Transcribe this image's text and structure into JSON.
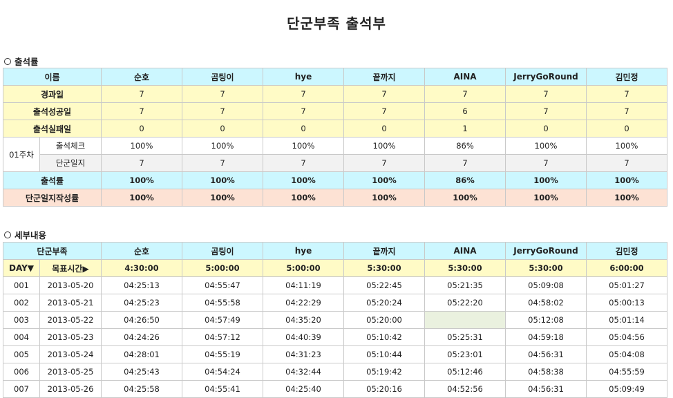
{
  "title": "단군부족 출석부",
  "attendance": {
    "section_label": "출석률",
    "header_label": "이름",
    "members": [
      "순호",
      "곰팅이",
      "hye",
      "끝까지",
      "AINA",
      "JerryGoRound",
      "김민정"
    ],
    "rows": {
      "elapsed": {
        "label": "경과일",
        "values": [
          "7",
          "7",
          "7",
          "7",
          "7",
          "7",
          "7"
        ]
      },
      "success": {
        "label": "출석성공일",
        "values": [
          "7",
          "7",
          "7",
          "7",
          "6",
          "7",
          "7"
        ]
      },
      "fail": {
        "label": "출석실패일",
        "values": [
          "0",
          "0",
          "0",
          "0",
          "1",
          "0",
          "0"
        ]
      },
      "week_label": "01주차",
      "check": {
        "label": "출석체크",
        "values": [
          "100%",
          "100%",
          "100%",
          "100%",
          "86%",
          "100%",
          "100%"
        ]
      },
      "journal": {
        "label": "단군일지",
        "values": [
          "7",
          "7",
          "7",
          "7",
          "7",
          "7",
          "7"
        ]
      },
      "rate": {
        "label": "출석률",
        "values": [
          "100%",
          "100%",
          "100%",
          "100%",
          "86%",
          "100%",
          "100%"
        ]
      },
      "journal_rate": {
        "label": "단군일지작성률",
        "values": [
          "100%",
          "100%",
          "100%",
          "100%",
          "100%",
          "100%",
          "100%"
        ]
      }
    }
  },
  "details": {
    "section_label": "세부내용",
    "header_label": "단군부족",
    "day_label": "DAY▼",
    "target_label": "목표시간▶",
    "targets": [
      "4:30:00",
      "5:00:00",
      "5:00:00",
      "5:30:00",
      "5:30:00",
      "5:30:00",
      "6:00:00"
    ],
    "days": [
      {
        "day": "001",
        "date": "2013-05-20",
        "times": [
          "04:25:13",
          "04:55:47",
          "04:11:19",
          "05:22:45",
          "05:21:35",
          "05:09:08",
          "05:01:27"
        ]
      },
      {
        "day": "002",
        "date": "2013-05-21",
        "times": [
          "04:25:23",
          "04:55:58",
          "04:22:29",
          "05:20:24",
          "05:22:20",
          "04:58:02",
          "05:00:13"
        ]
      },
      {
        "day": "003",
        "date": "2013-05-22",
        "times": [
          "04:26:50",
          "04:57:49",
          "04:35:20",
          "05:20:00",
          "",
          "05:12:08",
          "05:01:14"
        ]
      },
      {
        "day": "004",
        "date": "2013-05-23",
        "times": [
          "04:24:26",
          "04:57:12",
          "04:40:39",
          "05:10:42",
          "05:25:31",
          "04:59:18",
          "05:04:56"
        ]
      },
      {
        "day": "005",
        "date": "2013-05-24",
        "times": [
          "04:28:01",
          "04:55:19",
          "04:31:23",
          "05:10:44",
          "05:23:01",
          "04:56:31",
          "05:04:08"
        ]
      },
      {
        "day": "006",
        "date": "2013-05-25",
        "times": [
          "04:25:43",
          "04:54:24",
          "04:32:44",
          "05:19:42",
          "05:12:46",
          "04:58:38",
          "04:55:59"
        ]
      },
      {
        "day": "007",
        "date": "2013-05-26",
        "times": [
          "04:25:58",
          "04:55:41",
          "04:25:40",
          "05:20:16",
          "04:52:56",
          "04:56:31",
          "05:09:49"
        ]
      }
    ]
  }
}
